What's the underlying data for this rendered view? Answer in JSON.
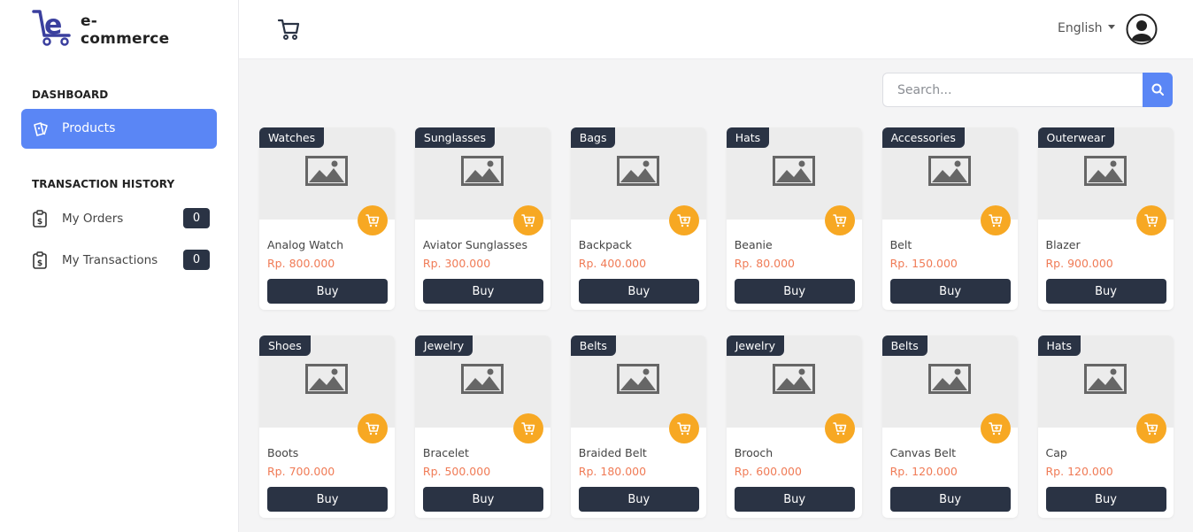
{
  "brand": {
    "logo_text": "e-commerce",
    "accent_color": "#5a86f5",
    "dark_color": "#2a3344",
    "orange_color": "#f7a823",
    "price_color": "#f07b56"
  },
  "sidebar": {
    "dashboard_title": "DASHBOARD",
    "products_label": "Products",
    "transaction_title": "TRANSACTION HISTORY",
    "items": [
      {
        "label": "My Orders",
        "count": "0",
        "icon": "receipt-dollar-icon"
      },
      {
        "label": "My Transactions",
        "count": "0",
        "icon": "receipt-dollar-icon"
      }
    ]
  },
  "header": {
    "language": "English",
    "cart_icon": "cart-icon",
    "avatar_icon": "user-avatar-icon"
  },
  "search": {
    "placeholder": "Search...",
    "icon": "search-icon"
  },
  "products": [
    {
      "category": "Watches",
      "name": "Analog Watch",
      "price": "Rp. 800.000",
      "button": "Buy"
    },
    {
      "category": "Sunglasses",
      "name": "Aviator Sunglasses",
      "price": "Rp. 300.000",
      "button": "Buy"
    },
    {
      "category": "Bags",
      "name": "Backpack",
      "price": "Rp. 400.000",
      "button": "Buy"
    },
    {
      "category": "Hats",
      "name": "Beanie",
      "price": "Rp. 80.000",
      "button": "Buy"
    },
    {
      "category": "Accessories",
      "name": "Belt",
      "price": "Rp. 150.000",
      "button": "Buy"
    },
    {
      "category": "Outerwear",
      "name": "Blazer",
      "price": "Rp. 900.000",
      "button": "Buy"
    },
    {
      "category": "Shoes",
      "name": "Boots",
      "price": "Rp. 700.000",
      "button": "Buy"
    },
    {
      "category": "Jewelry",
      "name": "Bracelet",
      "price": "Rp. 500.000",
      "button": "Buy"
    },
    {
      "category": "Belts",
      "name": "Braided Belt",
      "price": "Rp. 180.000",
      "button": "Buy"
    },
    {
      "category": "Jewelry",
      "name": "Brooch",
      "price": "Rp. 600.000",
      "button": "Buy"
    },
    {
      "category": "Belts",
      "name": "Canvas Belt",
      "price": "Rp. 120.000",
      "button": "Buy"
    },
    {
      "category": "Hats",
      "name": "Cap",
      "price": "Rp. 120.000",
      "button": "Buy"
    }
  ]
}
